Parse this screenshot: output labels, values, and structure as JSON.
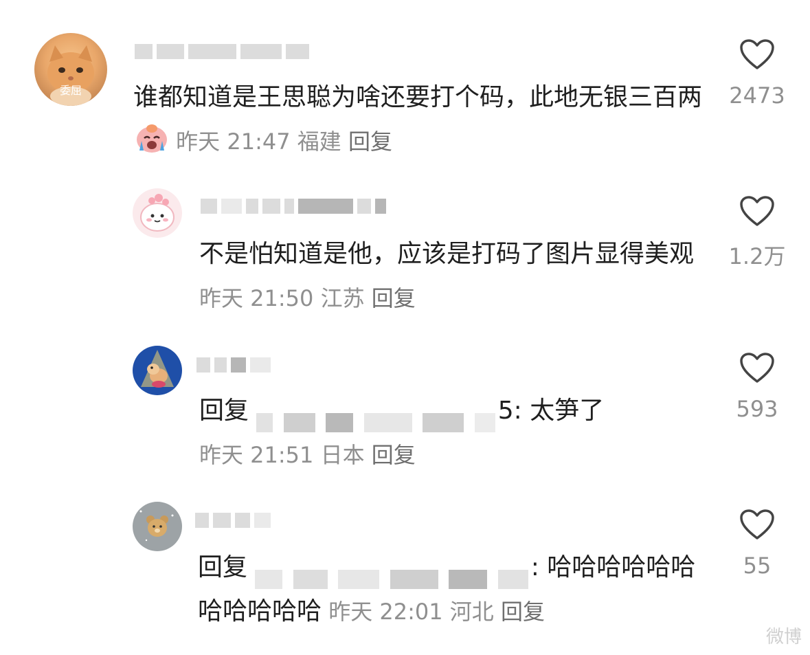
{
  "comments": [
    {
      "avatar_caption": "委屈",
      "text": "谁都知道是王思聪为啥还要打个码，此地无银三百两",
      "emoji": "crying-face-emoji",
      "time": "昨天 21:47",
      "location": "福建",
      "reply_label": "回复",
      "likes": "2473"
    },
    {
      "text": "不是怕知道是他，应该是打码了图片显得美观",
      "time": "昨天 21:50",
      "location": "江苏",
      "reply_label": "回复",
      "likes": "1.2万"
    },
    {
      "reply_prefix": "回复",
      "text_tail": "5: 太笋了",
      "time": "昨天 21:51",
      "location": "日本",
      "reply_label": "回复",
      "likes": "593"
    },
    {
      "reply_prefix": "回复",
      "text_tail": ": 哈哈哈哈哈哈",
      "text_line2": "哈哈哈哈哈",
      "time": "昨天 22:01",
      "location": "河北",
      "reply_label": "回复",
      "likes": "55"
    }
  ],
  "watermark": "微博",
  "colors": {
    "meta": "#8f8f8f",
    "text": "#1f1f1f",
    "heart": "#444444"
  }
}
